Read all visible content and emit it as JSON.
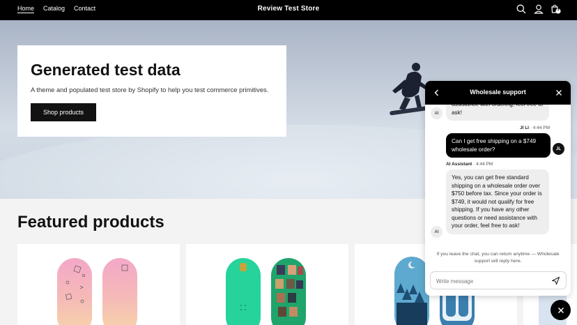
{
  "header": {
    "nav": [
      "Home",
      "Catalog",
      "Contact"
    ],
    "store_name": "Review Test Store",
    "icons": [
      "search-icon",
      "account-icon",
      "cart-icon"
    ],
    "cart_count": "1"
  },
  "hero": {
    "title": "Generated test data",
    "subtitle": "A theme and populated test store by Shopify to help you test commerce primitives.",
    "button": "Shop products"
  },
  "featured": {
    "heading": "Featured products"
  },
  "chat": {
    "title": "Wholesale support",
    "messages": [
      {
        "role": "ai",
        "avatar": "AI",
        "text": "assistance with ordering, feel free to ask!"
      },
      {
        "role": "user",
        "sender": "JI LI",
        "time": "4:44 PM",
        "avatar": "JL",
        "text": "Can I get free shipping on a $749 wholesale order?"
      },
      {
        "role": "ai",
        "sender": "AI Assistant",
        "time": "4:44 PM",
        "avatar": "AI",
        "text": "Yes, you can get free standard shipping on a wholesale order over $750 before tax. Since your order is $749, it would not qualify for free shipping. If you have any other questions or need assistance with your order, feel free to ask!"
      }
    ],
    "note": "If you leave the chat, you can return anytime — Wholesale support will reply here.",
    "input_placeholder": "Write message"
  },
  "colors": {
    "header_bg": "#000000",
    "button_bg": "#121212",
    "ai_bubble": "#eeeeee"
  }
}
